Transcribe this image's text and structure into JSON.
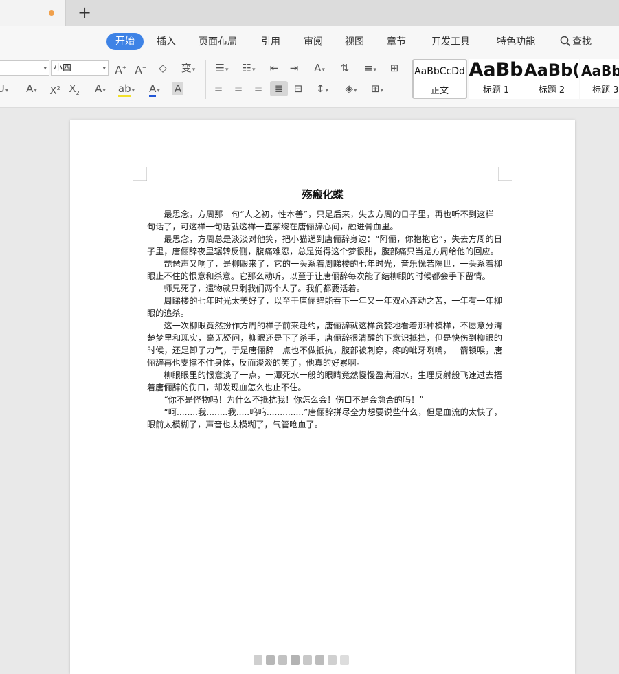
{
  "tabs": {
    "add_label": "+"
  },
  "menu": {
    "items": [
      "开始",
      "插入",
      "页面布局",
      "引用",
      "审阅",
      "视图",
      "章节",
      "开发工具",
      "特色功能"
    ],
    "search_label": "查找"
  },
  "ribbon": {
    "font_size": "小四",
    "styles": [
      {
        "sample": "AaBbCcDd",
        "name": "正文"
      },
      {
        "sample": "AaBb",
        "name": "标题 1"
      },
      {
        "sample": "AaBb(",
        "name": "标题 2"
      },
      {
        "sample": "AaBb",
        "name": "标题 3"
      }
    ]
  },
  "document": {
    "title": "殇瘢化蝶",
    "paragraphs": [
      "最思念，方周那一句“人之初，性本善”，只是后来，失去方周的日子里，再也听不到这样一句话了，可这样一句话就这样一直萦绕在唐俪辞心间，融进骨血里。",
      "最思念，方周总是淡淡对他笑，把小猫递到唐俪辞身边：“阿俪，你抱抱它”，失去方周的日子里，唐俪辞夜里辗转反侧，腹痛难忍，总是觉得这个梦很甜，腹部痛只当是方周给他的回应。",
      "琵琶声又响了，是柳眼来了，它的一头系着周睇楼的七年时光，音乐恍若隔世，一头系着柳眼止不住的恨意和杀意。它那么动听，以至于让唐俪辞每次能了结柳眼的时候都会手下留情。",
      "师兄死了，遗物就只剩我们两个人了。我们都要活着。",
      "周睇楼的七年时光太美好了，以至于唐俪辞能吞下一年又一年双心连动之苦，一年有一年柳眼的追杀。",
      "这一次柳眼竟然扮作方周的样子前来赴约，唐俪辞就这样贪婪地看着那种模样，不愿意分清楚梦里和现实，毫无疑问，柳眼还是下了杀手，唐俪辞很清醒的下意识抵挡，但是快伤到柳眼的时候，还是卸了力气，于是唐俪辞一点也不做抵抗，腹部被刺穿，疼的呲牙咧嘴，一箭锁喉，唐俪辞再也支撑不住身体，反而淡淡的笑了，他真的好累啊。",
      "柳眼眼里的恨意淡了一点，一潭死水一般的眼睛竟然慢慢盈满泪水，生理反射般飞速过去捂着唐俪辞的伤口，却发现血怎么也止不住。",
      "“你不是怪物吗！为什么不抵抗我！你怎么会！伤口不是会愈合的吗！”",
      "“呵........我........我.....呜呜..............”唐俪辞拼尽全力想要说些什么，但是血流的太快了，眼前太模糊了，声音也太模糊了，气管呛血了。"
    ]
  }
}
